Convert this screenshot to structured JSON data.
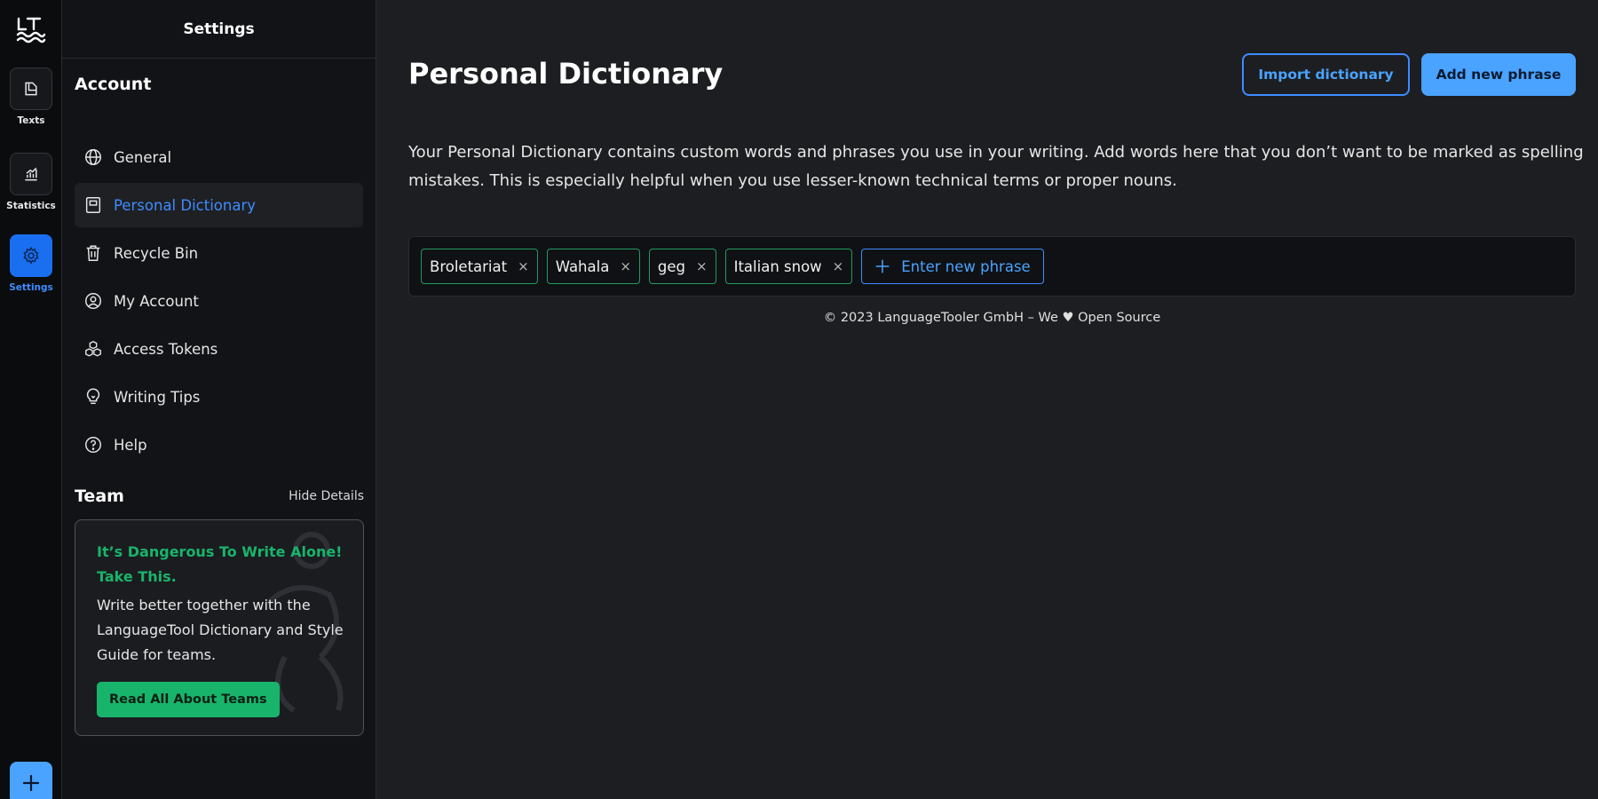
{
  "rail": {
    "logo": "LT",
    "items": [
      {
        "label": "Texts",
        "icon": "document-icon"
      },
      {
        "label": "Statistics",
        "icon": "chart-icon"
      },
      {
        "label": "Settings",
        "icon": "gear-icon"
      }
    ],
    "add": "+"
  },
  "sidebar": {
    "header": "Settings",
    "account_title": "Account",
    "items": [
      {
        "label": "General",
        "icon": "globe-icon"
      },
      {
        "label": "Personal Dictionary",
        "icon": "book-icon"
      },
      {
        "label": "Recycle Bin",
        "icon": "trash-icon"
      },
      {
        "label": "My Account",
        "icon": "user-circle-icon"
      },
      {
        "label": "Access Tokens",
        "icon": "cubes-icon"
      },
      {
        "label": "Writing Tips",
        "icon": "lightbulb-icon"
      },
      {
        "label": "Help",
        "icon": "help-icon"
      }
    ],
    "team": {
      "title": "Team",
      "hide_details": "Hide Details",
      "heading": "It’s Dangerous To Write Alone! Take This.",
      "body": "Write better together with the LanguageTool Dictionary and Style Guide for teams.",
      "button": "Read All About Teams"
    }
  },
  "main": {
    "title": "Personal Dictionary",
    "import_button": "Import dictionary",
    "add_button": "Add new phrase",
    "description": "Your Personal Dictionary contains custom words and phrases you use in your writing. Add words here that you don’t want to be marked as spelling mistakes. This is especially helpful when you use lesser-known technical terms or proper nouns.",
    "phrases": [
      "Broletariat",
      "Wahala",
      "geg",
      "Italian snow"
    ],
    "remove_symbol": "×",
    "enter_phrase": "Enter new phrase",
    "footer": "© 2023 LanguageTooler GmbH – We ♥ Open Source"
  },
  "colors": {
    "accent": "#3d8cff",
    "green": "#19b46b",
    "background": "#1d1e21"
  }
}
